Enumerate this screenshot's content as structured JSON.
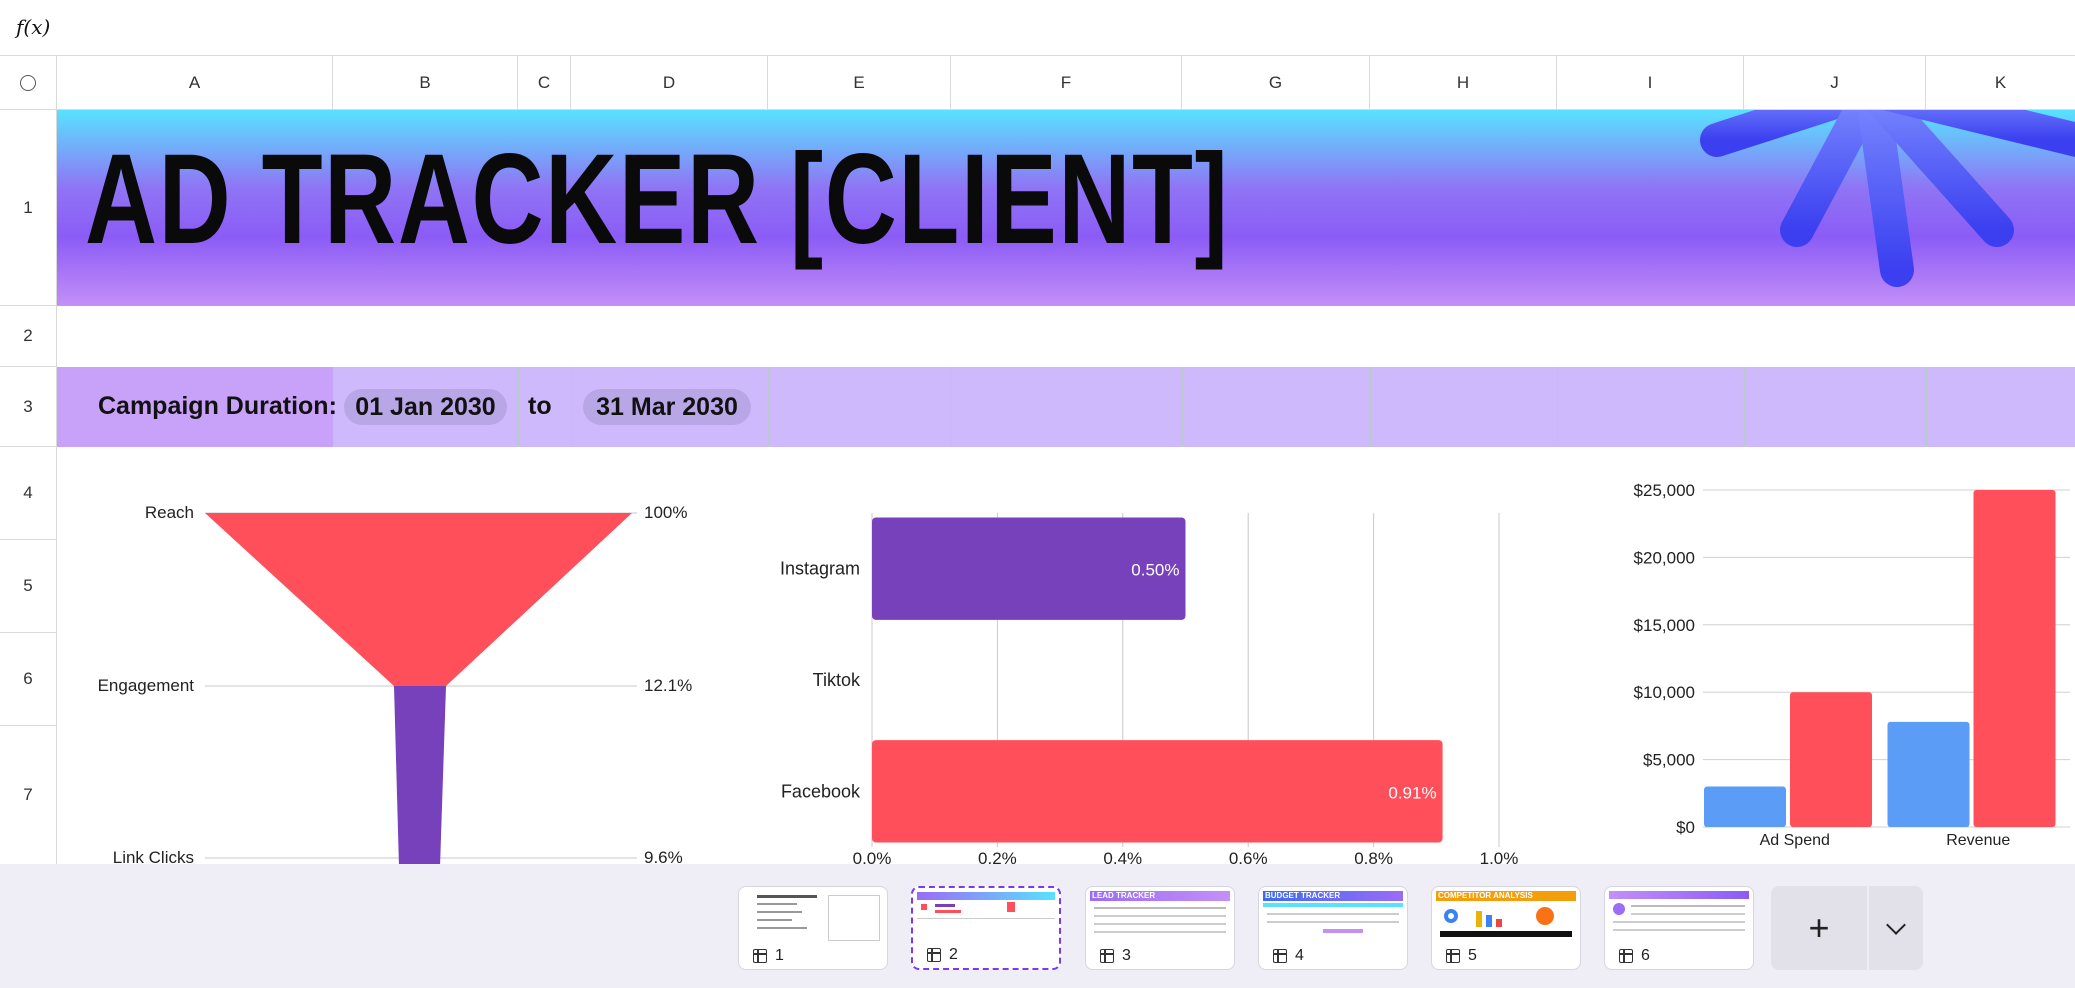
{
  "formula_bar": {
    "label": "f(x)"
  },
  "columns": [
    "A",
    "B",
    "C",
    "D",
    "E",
    "F",
    "G",
    "H",
    "I",
    "J",
    "K"
  ],
  "rows": [
    "1",
    "2",
    "3",
    "4",
    "5",
    "6",
    "7"
  ],
  "banner": {
    "title": "AD TRACKER [CLIENT]"
  },
  "campaign": {
    "label": "Campaign Duration:",
    "start": "01 Jan 2030",
    "to": "to",
    "end": "31 Mar 2030"
  },
  "funnel": {
    "stages": [
      "Reach",
      "Engagement",
      "Link Clicks"
    ],
    "percent_labels": [
      "100%",
      "12.1%",
      "9.6%"
    ],
    "colors": {
      "top": "#ff4f5a",
      "body": "#7741bb"
    }
  },
  "chart_data": [
    {
      "type": "bar",
      "orientation": "horizontal",
      "categories": [
        "Instagram",
        "Tiktok",
        "Facebook"
      ],
      "values": [
        0.5,
        0,
        0.91
      ],
      "data_labels": [
        "0.50%",
        "",
        "0.91%"
      ],
      "bar_colors": [
        "#7741bb",
        "#7741bb",
        "#ff4f5a"
      ],
      "xlim": [
        0,
        1.0
      ],
      "x_ticks": [
        "0.0%",
        "0.2%",
        "0.4%",
        "0.6%",
        "0.8%",
        "1.0%"
      ],
      "grid": true
    },
    {
      "type": "bar",
      "categories": [
        "Ad Spend",
        "Revenue"
      ],
      "series": [
        {
          "values": [
            3000,
            7800
          ],
          "color": "#5b9cf6"
        },
        {
          "values": [
            10000,
            25000
          ],
          "color": "#ff4f5a"
        }
      ],
      "ylim": [
        0,
        25000
      ],
      "y_ticks": [
        "$0",
        "$5,000",
        "$10,000",
        "$15,000",
        "$20,000",
        "$25,000"
      ],
      "grid": true
    }
  ],
  "sheets": [
    {
      "label": "1",
      "active": false
    },
    {
      "label": "2",
      "active": true
    },
    {
      "label": "3",
      "active": false,
      "preview_title": "LEAD TRACKER"
    },
    {
      "label": "4",
      "active": false,
      "preview_title": "BUDGET TRACKER"
    },
    {
      "label": "5",
      "active": false,
      "preview_title": "COMPETITOR ANALYSIS"
    },
    {
      "label": "6",
      "active": false
    }
  ],
  "add_sheet": {
    "label": "+"
  }
}
